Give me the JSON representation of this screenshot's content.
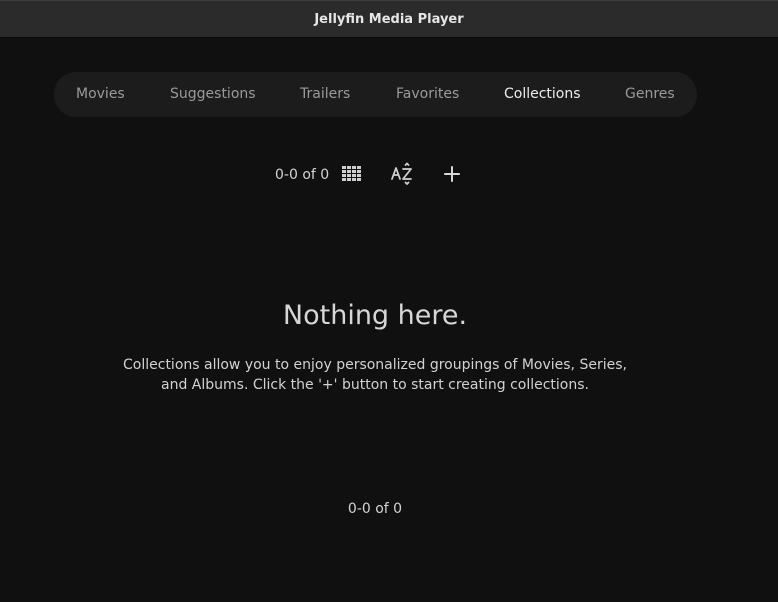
{
  "window": {
    "title": "Jellyfin Media Player"
  },
  "tabs": [
    {
      "label": "Movies",
      "active": false
    },
    {
      "label": "Suggestions",
      "active": false
    },
    {
      "label": "Trailers",
      "active": false
    },
    {
      "label": "Favorites",
      "active": false
    },
    {
      "label": "Collections",
      "active": true
    },
    {
      "label": "Genres",
      "active": false
    }
  ],
  "toolbar": {
    "count": "0-0 of 0",
    "icons": [
      "grid-view-icon",
      "sort-az-icon",
      "add-icon"
    ]
  },
  "empty_state": {
    "title": "Nothing here.",
    "description": "Collections allow you to enjoy personalized groupings of Movies, Series, and Albums. Click the '+' button to start creating collections."
  },
  "pagination": {
    "count": "0-0 of 0"
  },
  "colors": {
    "background": "#101010",
    "titlebar": "#2b2b2b",
    "tab_bar": "#1c1c1c",
    "text_active": "#ededed",
    "text_inactive": "#9a9a9a"
  }
}
